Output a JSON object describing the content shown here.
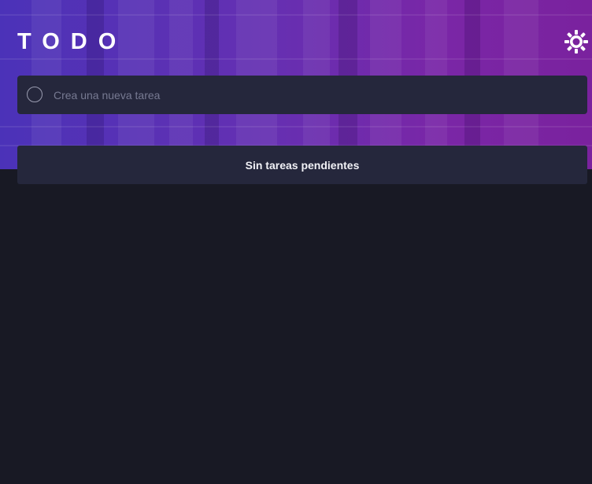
{
  "header": {
    "title": "TODO",
    "theme_toggle_icon": "sun-icon"
  },
  "new_task": {
    "placeholder": "Crea una nueva tarea",
    "value": "",
    "check_icon": "circle-icon"
  },
  "task_list": {
    "items": [],
    "empty_message": "Sin tareas pendientes"
  },
  "colors": {
    "background": "#181924",
    "panel": "#25273c",
    "hero_start": "#4b32b8",
    "hero_end": "#7a229e",
    "text_light": "#f1f1f6",
    "placeholder": "#777a92"
  }
}
